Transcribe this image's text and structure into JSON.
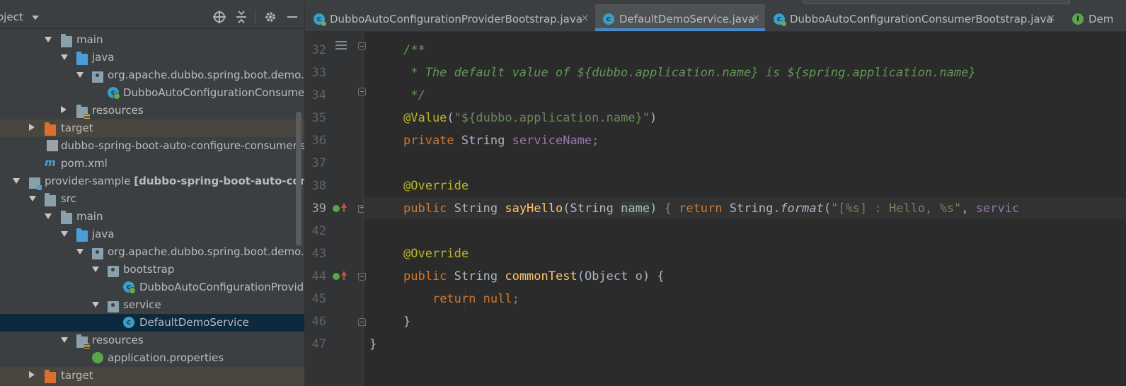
{
  "project_panel": {
    "title": "oject",
    "tree": [
      {
        "label": "main",
        "kind": "folder",
        "expanded": true
      },
      {
        "label": "java",
        "kind": "source-folder",
        "expanded": true
      },
      {
        "label": "org.apache.dubbo.spring.boot.demo.c",
        "kind": "package",
        "expanded": true
      },
      {
        "label": "DubboAutoConfigurationConsumer",
        "kind": "class"
      },
      {
        "label": "resources",
        "kind": "resources-folder",
        "expanded": false
      },
      {
        "label": "target",
        "kind": "excluded-folder",
        "expanded": false
      },
      {
        "label": "dubbo-spring-boot-auto-configure-consumer-s",
        "kind": "file"
      },
      {
        "label": "pom.xml",
        "kind": "maven-file"
      },
      {
        "label": "provider-sample",
        "module": "[dubbo-spring-boot-auto-config",
        "kind": "module",
        "expanded": true
      },
      {
        "label": "src",
        "kind": "folder",
        "expanded": true
      },
      {
        "label": "main",
        "kind": "folder",
        "expanded": true
      },
      {
        "label": "java",
        "kind": "source-folder",
        "expanded": true
      },
      {
        "label": "org.apache.dubbo.spring.boot.demo.p",
        "kind": "package",
        "expanded": true
      },
      {
        "label": "bootstrap",
        "kind": "package",
        "expanded": true
      },
      {
        "label": "DubboAutoConfigurationProvide",
        "kind": "class"
      },
      {
        "label": "service",
        "kind": "package",
        "expanded": true
      },
      {
        "label": "DefaultDemoService",
        "kind": "class",
        "selected": true
      },
      {
        "label": "resources",
        "kind": "resources-folder",
        "expanded": true
      },
      {
        "label": "application.properties",
        "kind": "properties-file"
      },
      {
        "label": "target",
        "kind": "excluded-folder",
        "expanded": false
      }
    ]
  },
  "tabs": [
    {
      "label": "DubboAutoConfigurationProviderBootstrap.java",
      "active": false,
      "close": "×"
    },
    {
      "label": "DefaultDemoService.java",
      "active": true,
      "close": "×"
    },
    {
      "label": "DubboAutoConfigurationConsumerBootstrap.java",
      "active": false,
      "close": "×"
    },
    {
      "label": "Dem",
      "active": false,
      "close": ""
    }
  ],
  "editor": {
    "line_numbers": [
      "32",
      "33",
      "34",
      "35",
      "36",
      "37",
      "38",
      "39",
      "42",
      "43",
      "44",
      "45",
      "46",
      "47"
    ],
    "current_line": "39",
    "code": {
      "l32": "/**",
      "l33": " * The default value of ${dubbo.application.name} is ${spring.application.name}",
      "l34": " */",
      "l35_anno": "@Value",
      "l35_str": "\"${dubbo.application.name}\"",
      "l36_kw": "private",
      "l36_type": "String",
      "l36_field": "serviceName",
      "l38": "@Override",
      "l39_kw": "public",
      "l39_type": "String",
      "l39_method": "sayHello",
      "l39_param": "String",
      "l39_name": "name",
      "l39_return": "return",
      "l39_class": "String",
      "l39_call": "format",
      "l39_str": "\"[%s] : Hello, %s\"",
      "l39_arg": "servic",
      "l43": "@Override",
      "l44_kw": "public",
      "l44_type": "String",
      "l44_method": "commonTest",
      "l44_param": "Object o",
      "l45_kw": "return",
      "l45_null": "null",
      "l46": "}",
      "l47": "}"
    }
  },
  "colors": {
    "keyword": "#cc7832",
    "annotation": "#bbb529",
    "string": "#6a8759",
    "field": "#9876aa",
    "method": "#ffc66d",
    "comment": "#629755",
    "selection": "#0d293e",
    "accent": "#4a88c7"
  }
}
